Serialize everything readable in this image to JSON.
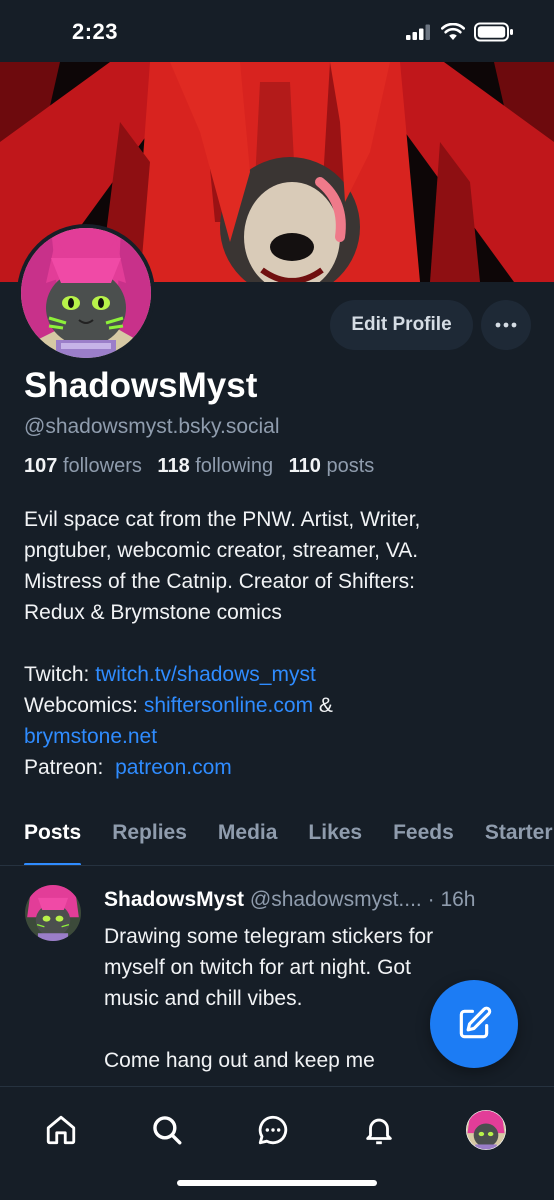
{
  "status_bar": {
    "time": "2:23",
    "icons": [
      "cellular-signal-icon",
      "wifi-icon",
      "battery-icon"
    ]
  },
  "profile": {
    "display_name": "ShadowsMyst",
    "handle": "@shadowsmyst.bsky.social",
    "stats": {
      "followers_count": "107",
      "followers_label": "followers",
      "following_count": "118",
      "following_label": "following",
      "posts_count": "110",
      "posts_label": "posts"
    },
    "edit_button_label": "Edit Profile",
    "more_button_icon": "more-horizontal-icon",
    "bio": {
      "lines": [
        "Evil space cat from the PNW. Artist, Writer,",
        "pngtuber, webcomic creator, streamer, VA.",
        "Mistress of the Catnip. Creator of Shifters:",
        "Redux & Brymstone comics"
      ],
      "twitch_label": "Twitch:",
      "twitch_link": "twitch.tv/shadows_myst",
      "webcomics_label": "Webcomics:",
      "webcomics_link_1": "shiftersonline.com",
      "webcomics_amp": "&",
      "webcomics_link_2": "brymstone.net",
      "patreon_label": "Patreon:",
      "patreon_link": "patreon.com"
    }
  },
  "tabs": [
    {
      "label": "Posts",
      "active": true
    },
    {
      "label": "Replies",
      "active": false
    },
    {
      "label": "Media",
      "active": false
    },
    {
      "label": "Likes",
      "active": false
    },
    {
      "label": "Feeds",
      "active": false
    },
    {
      "label": "Starter Packs",
      "active": false
    }
  ],
  "post": {
    "author": "ShadowsMyst",
    "handle": "@shadowsmyst....",
    "separator": "·",
    "time": "16h",
    "text_lines": [
      "Drawing some telegram stickers for",
      "myself on twitch for art night. Got",
      "music and chill vibes."
    ],
    "text_lines_2": [
      "Come hang out and keep me"
    ]
  },
  "fab_icon": "compose-icon",
  "bottom_nav": [
    "home-icon",
    "search-icon",
    "chat-icon",
    "notifications-bell-icon",
    "profile-avatar"
  ],
  "colors": {
    "background": "#161e27",
    "accent": "#2f8cff",
    "fab": "#1c7cf4",
    "muted_text": "#8f9cad",
    "button_bg": "#1e2936"
  }
}
